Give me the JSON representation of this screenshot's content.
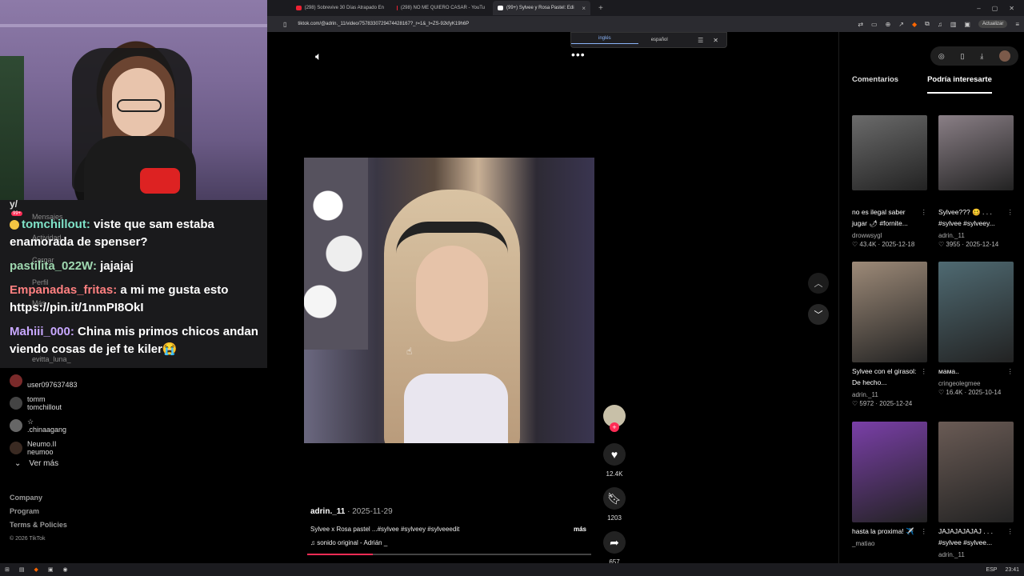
{
  "browser": {
    "tabs": [
      {
        "title": "(298) Sobrevive 30 Días Atrapado En",
        "active": false
      },
      {
        "title": "(298) NO ME QUIERO CASAR - YouTu",
        "active": false
      },
      {
        "title": "(99+) Sylvee y Rosa Pastel: Edi",
        "active": true
      }
    ],
    "new_tab": "+",
    "url": "tiktok.com/@adrin._11/video/7578330729474428167?_r=1&_t=ZS-92kfyK19h6P",
    "update_label": "Actualizar"
  },
  "translate": {
    "lang_a": "inglés",
    "lang_b": "español"
  },
  "stream": {
    "chat": [
      {
        "user": "tomchillout:",
        "user_color": "#7fe3c8",
        "text": " viste que sam estaba enamorada de spenser?"
      },
      {
        "user": "pastilita_022W:",
        "user_color": "#9fd8b0",
        "text": " jajajaj"
      },
      {
        "user": "Empanadas_fritas:",
        "user_color": "#ff8080",
        "text": " a mi me gusta esto https://pin.it/1nmPI8OkI"
      },
      {
        "user": "Mahiii_000:",
        "user_color": "#c8a8ff",
        "text": " China mis primos chicos andan viendo cosas de jef te kiler😭"
      }
    ],
    "ghost_labels": {
      "top_char": "y/",
      "messages": "Mensajes",
      "activity": "Actividad",
      "upload": "Cargar",
      "profile": "Perfil",
      "more": "Más",
      "badge_count": "99+",
      "evitta": "evitta_luna_"
    }
  },
  "following": [
    {
      "name": "",
      "handle": "user097637483"
    },
    {
      "name": "tomm",
      "handle": "tomchillout"
    },
    {
      "name": "☆",
      "handle": ".chinaagang"
    },
    {
      "name": "Neumo.II",
      "handle": "neumoo"
    }
  ],
  "ver_mas": "Ver más",
  "footer": {
    "company": "Company",
    "program": "Program",
    "terms": "Terms & Policies",
    "copyright": "© 2026 TikTok"
  },
  "video": {
    "author": "adrin._11",
    "date": " · 2025-11-29",
    "description": "Sylvee x Rosa pastel ...#sylvee #sylveey #sylveeedit",
    "more": "más",
    "music": "♫  sonido original - Adrián _",
    "likes": "12.4K",
    "saves": "1203",
    "shares": "657",
    "progress": 0.23
  },
  "right": {
    "tab_comments": "Comentarios",
    "tab_interest": "Podría interesarte",
    "cards": [
      {
        "title": "no es ilegal saber jugar 🌶 #fornite...",
        "author": "",
        "stats": "drowwsygl",
        "likes": "♡ 43.4K · 2025-12-18",
        "color": "#6b6b6b"
      },
      {
        "title": "Sylvee??? 🥴 . . . #sylvee #sylveey...",
        "author": "",
        "stats": "adrin._11",
        "likes": "♡ 3955 · 2025-12-14",
        "color": "#8a7f86"
      },
      {
        "title": "Sylvee con el girasol: De hecho...",
        "author": "adrin._11",
        "stats": "",
        "likes": "♡ 5972 · 2025-12-24",
        "color": "#9d8a78"
      },
      {
        "title": "мама..",
        "author": "cringeolegmee",
        "stats": "",
        "likes": "♡ 16.4K · 2025-10-14",
        "color": "#4f6a72"
      },
      {
        "title": "hasta la proxima! ✈️",
        "author": "_matiao",
        "stats": "",
        "likes": "",
        "color": "#7a3fa8"
      },
      {
        "title": "JAJAJAJAJAJ . . . #sylvee #sylvee...",
        "author": "adrin._11",
        "stats": "",
        "likes": "",
        "color": "#6a5b55"
      }
    ]
  },
  "taskbar": {
    "lang": "ESP",
    "time": "23:41"
  }
}
